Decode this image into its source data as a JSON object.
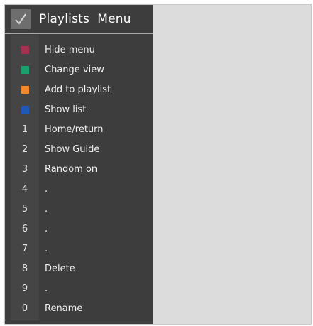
{
  "header": {
    "title": "Playlists  Menu",
    "check_icon": "checkmark-icon"
  },
  "colors": {
    "menu_bg": "#3d3d3d",
    "panel_bg": "#dcdcdc",
    "red": "#a3314f",
    "green": "#1c9e6d",
    "orange": "#f08a2c",
    "blue": "#1f58b5"
  },
  "items": [
    {
      "key": "",
      "swatch": "red",
      "label": "Hide menu"
    },
    {
      "key": "",
      "swatch": "green",
      "label": "Change view"
    },
    {
      "key": "",
      "swatch": "orange",
      "label": "Add to playlist"
    },
    {
      "key": "",
      "swatch": "blue",
      "label": "Show list"
    },
    {
      "key": "1",
      "swatch": "",
      "label": "Home/return"
    },
    {
      "key": "2",
      "swatch": "",
      "label": "Show Guide"
    },
    {
      "key": "3",
      "swatch": "",
      "label": "Random on"
    },
    {
      "key": "4",
      "swatch": "",
      "label": "."
    },
    {
      "key": "5",
      "swatch": "",
      "label": "."
    },
    {
      "key": "6",
      "swatch": "",
      "label": "."
    },
    {
      "key": "7",
      "swatch": "",
      "label": "."
    },
    {
      "key": "8",
      "swatch": "",
      "label": "Delete"
    },
    {
      "key": "9",
      "swatch": "",
      "label": "."
    },
    {
      "key": "0",
      "swatch": "",
      "label": "Rename"
    }
  ]
}
